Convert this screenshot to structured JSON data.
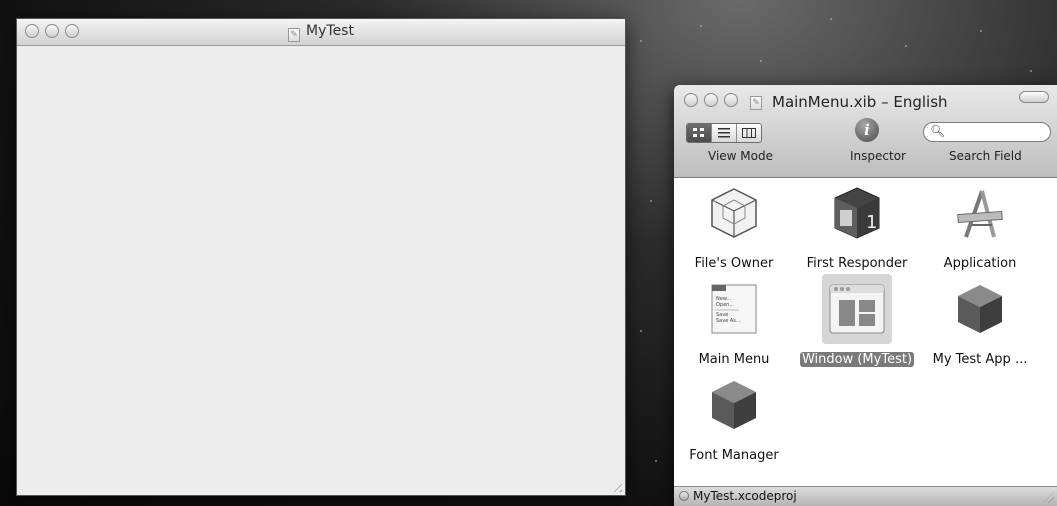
{
  "left_window": {
    "title": "MyTest"
  },
  "right_window": {
    "title": "MainMenu.xib – English",
    "toolbar": {
      "view_mode_label": "View Mode",
      "inspector_label": "Inspector",
      "search_label": "Search Field",
      "view_modes": [
        "icon-view-icon",
        "list-view-icon",
        "column-view-icon"
      ],
      "selected_view_mode": "icon-view-icon"
    },
    "objects": [
      {
        "label": "File's Owner",
        "icon": "files-owner-cube-icon"
      },
      {
        "label": "First Responder",
        "icon": "first-responder-icon"
      },
      {
        "label": "Application",
        "icon": "application-icon"
      },
      {
        "label": "Main Menu",
        "icon": "main-menu-icon"
      },
      {
        "label": "Window (MyTest)",
        "icon": "window-icon",
        "selected": true
      },
      {
        "label": "My Test App ...",
        "icon": "object-cube-icon"
      },
      {
        "label": "Font Manager",
        "icon": "font-manager-cube-icon"
      }
    ],
    "menu_preview_lines": [
      "New...",
      "Open...",
      "Save",
      "Save As..."
    ],
    "status_bar": {
      "project": "MyTest.xcodeproj"
    }
  }
}
